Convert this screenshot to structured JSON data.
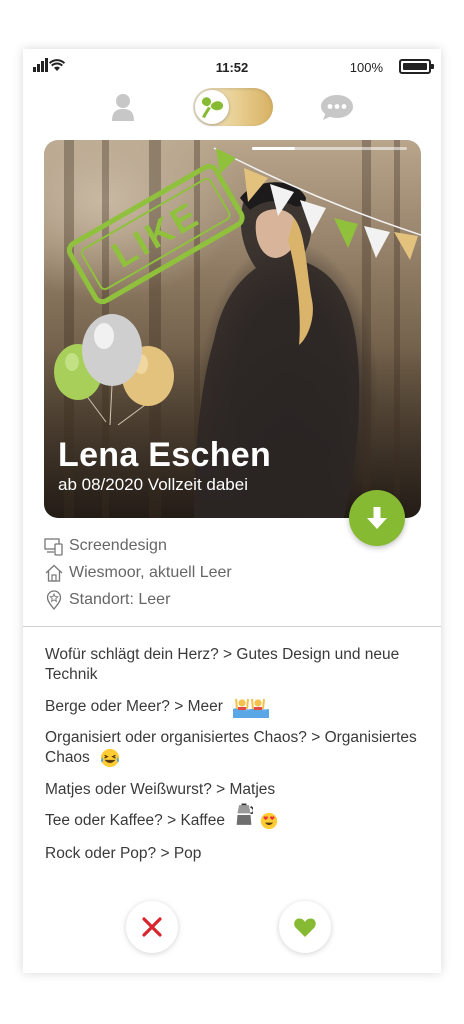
{
  "status_bar": {
    "time": "11:52",
    "battery_percent": "100%"
  },
  "top_nav": {
    "profile_icon": "person-icon",
    "mode_toggle": {
      "icon": "leaf-logo-icon",
      "state": "on"
    },
    "chat_icon": "chat-bubble-icon"
  },
  "card": {
    "name": "Lena Eschen",
    "subtitle": "ab 08/2020 Vollzeit dabei",
    "stamp": "LIKE",
    "progress": 0.28,
    "download_icon": "download-arrow-icon"
  },
  "info": [
    {
      "icon": "devices-icon",
      "label": "Screendesign"
    },
    {
      "icon": "home-icon",
      "label": "Wiesmoor, aktuell Leer"
    },
    {
      "icon": "location-pin-icon",
      "label": "Standort: Leer"
    }
  ],
  "qa": [
    {
      "text": "Wofür schlägt dein Herz? > Gutes Design und neue Technik"
    },
    {
      "text": "Berge oder Meer? > Meer",
      "emoji": "swimmers-emoji"
    },
    {
      "text": "Organisiert oder organisiertes Chaos? > Organisiertes Chaos",
      "emoji": "laughing-tears-emoji"
    },
    {
      "text": "Matjes oder Weißwurst? > Matjes"
    },
    {
      "text": "Tee oder Kaffee? > Kaffee",
      "emoji": "moka-pot-and-heart-eyes-emoji"
    },
    {
      "text": "Rock oder Pop? > Pop"
    }
  ],
  "actions": {
    "dislike_icon": "close-x-icon",
    "like_icon": "heart-icon"
  },
  "colors": {
    "accent_green": "#86ba32",
    "gold": "#e3c27e",
    "dislike_red": "#d9232d",
    "text": "#3a3a3a"
  }
}
